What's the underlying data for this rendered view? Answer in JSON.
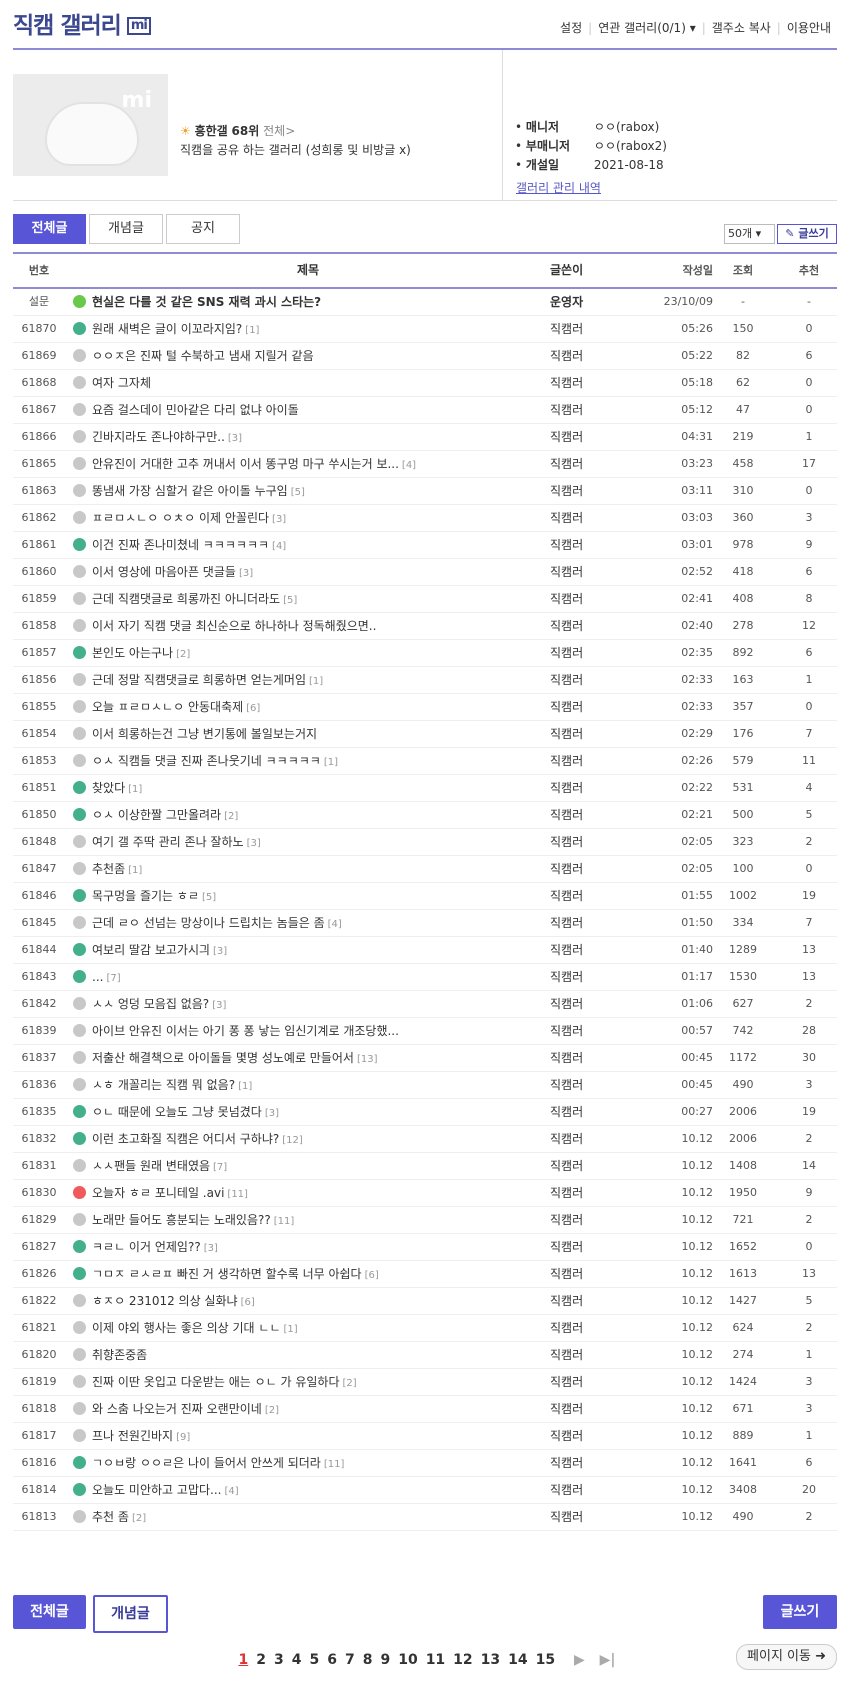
{
  "header": {
    "title": "직캠 갤러리",
    "badge": "mi",
    "links": [
      "설정",
      "연관 갤러리(0/1) ▾",
      "갤주소 복사",
      "이용안내"
    ]
  },
  "info": {
    "thumb_mark": "mi",
    "rank_label": "흥한갤",
    "rank_value": "68위",
    "rank_all": "전체",
    "description": "직캠을 공유 하는 갤러리 (성희롱 및 비방글 x)",
    "manager_label": "매니저",
    "manager_value": "ㅇㅇ(rabox)",
    "submanager_label": "부매니저",
    "submanager_value": "ㅇㅇ(rabox2)",
    "opened_label": "개설일",
    "opened_value": "2021-08-18",
    "log_link": "갤러리 관리 내역"
  },
  "tabs": {
    "all": "전체글",
    "concept": "개념글",
    "notice": "공지"
  },
  "list_controls": {
    "count": "50개",
    "write": "글쓰기"
  },
  "table": {
    "headers": {
      "no": "번호",
      "title": "제목",
      "writer": "글쓴이",
      "date": "작성일",
      "views": "조회",
      "recommends": "추천"
    },
    "rows": [
      {
        "no": "설문",
        "icon": "not",
        "title": "현실은 다를 것 같은 SNS 재력 과시 스타는?",
        "cm": "",
        "writer": "운영자",
        "date": "23/10/09",
        "views": "-",
        "rec": "-",
        "notice": true
      },
      {
        "no": "61870",
        "icon": "img",
        "title": "원래 새벽은 글이 이꼬라지임?",
        "cm": "[1]",
        "writer": "직캠러",
        "date": "05:26",
        "views": "150",
        "rec": "0"
      },
      {
        "no": "61869",
        "icon": "txt",
        "title": "ㅇㅇㅈ은 진짜 털 수북하고 냄새 지릴거 같음",
        "cm": "",
        "writer": "직캠러",
        "date": "05:22",
        "views": "82",
        "rec": "6"
      },
      {
        "no": "61868",
        "icon": "txt",
        "title": "여자 그자체",
        "cm": "",
        "writer": "직캠러",
        "date": "05:18",
        "views": "62",
        "rec": "0"
      },
      {
        "no": "61867",
        "icon": "txt",
        "title": "요즘 걸스데이 민아같은 다리 없냐 아이돌",
        "cm": "",
        "writer": "직캠러",
        "date": "05:12",
        "views": "47",
        "rec": "0"
      },
      {
        "no": "61866",
        "icon": "txt",
        "title": "긴바지라도 존나야하구만..",
        "cm": "[3]",
        "writer": "직캠러",
        "date": "04:31",
        "views": "219",
        "rec": "1"
      },
      {
        "no": "61865",
        "icon": "txt",
        "title": "안유진이 거대한 고추 꺼내서 이서 똥구멍 마구 쑤시는거 보...",
        "cm": "[4]",
        "writer": "직캠러",
        "date": "03:23",
        "views": "458",
        "rec": "17"
      },
      {
        "no": "61863",
        "icon": "txt",
        "title": "똥냄새 가장 심할거 같은 아이돌 누구임",
        "cm": "[5]",
        "writer": "직캠러",
        "date": "03:11",
        "views": "310",
        "rec": "0"
      },
      {
        "no": "61862",
        "icon": "txt",
        "title": "ㅍㄹㅁㅅㄴㅇ ㅇㅊㅇ 이제 안꼴린다",
        "cm": "[3]",
        "writer": "직캠러",
        "date": "03:03",
        "views": "360",
        "rec": "3"
      },
      {
        "no": "61861",
        "icon": "img",
        "title": "이건 진짜 존나미쳤네 ㅋㅋㅋㅋㅋㅋ",
        "cm": "[4]",
        "writer": "직캠러",
        "date": "03:01",
        "views": "978",
        "rec": "9"
      },
      {
        "no": "61860",
        "icon": "txt",
        "title": "이서 영상에 마음아픈 댓글들",
        "cm": "[3]",
        "writer": "직캠러",
        "date": "02:52",
        "views": "418",
        "rec": "6"
      },
      {
        "no": "61859",
        "icon": "txt",
        "title": "근데 직캠댓글로 희롱까진 아니더라도",
        "cm": "[5]",
        "writer": "직캠러",
        "date": "02:41",
        "views": "408",
        "rec": "8"
      },
      {
        "no": "61858",
        "icon": "txt",
        "title": "이서 자기 직캠 댓글 최신순으로 하나하나 정독해줬으면..",
        "cm": "",
        "writer": "직캠러",
        "date": "02:40",
        "views": "278",
        "rec": "12"
      },
      {
        "no": "61857",
        "icon": "img",
        "title": "본인도 아는구나",
        "cm": "[2]",
        "writer": "직캠러",
        "date": "02:35",
        "views": "892",
        "rec": "6"
      },
      {
        "no": "61856",
        "icon": "txt",
        "title": "근데 정말 직캠댓글로 희롱하면 얻는게머임",
        "cm": "[1]",
        "writer": "직캠러",
        "date": "02:33",
        "views": "163",
        "rec": "1"
      },
      {
        "no": "61855",
        "icon": "txt",
        "title": "오늘 ㅍㄹㅁㅅㄴㅇ 안동대축제",
        "cm": "[6]",
        "writer": "직캠러",
        "date": "02:33",
        "views": "357",
        "rec": "0"
      },
      {
        "no": "61854",
        "icon": "txt",
        "title": "이서 희롱하는건 그냥 변기통에 볼일보는거지",
        "cm": "",
        "writer": "직캠러",
        "date": "02:29",
        "views": "176",
        "rec": "7"
      },
      {
        "no": "61853",
        "icon": "txt",
        "title": "ㅇㅅ 직캠들 댓글 진짜 존나웃기네 ㅋㅋㅋㅋㅋ",
        "cm": "[1]",
        "writer": "직캠러",
        "date": "02:26",
        "views": "579",
        "rec": "11"
      },
      {
        "no": "61851",
        "icon": "img",
        "title": "찾았다",
        "cm": "[1]",
        "writer": "직캠러",
        "date": "02:22",
        "views": "531",
        "rec": "4"
      },
      {
        "no": "61850",
        "icon": "img",
        "title": "ㅇㅅ 이상한짤 그만올려라",
        "cm": "[2]",
        "writer": "직캠러",
        "date": "02:21",
        "views": "500",
        "rec": "5"
      },
      {
        "no": "61848",
        "icon": "txt",
        "title": "여기 갤 주딱 관리 존나 잘하노",
        "cm": "[3]",
        "writer": "직캠러",
        "date": "02:05",
        "views": "323",
        "rec": "2"
      },
      {
        "no": "61847",
        "icon": "txt",
        "title": "추천좀",
        "cm": "[1]",
        "writer": "직캠러",
        "date": "02:05",
        "views": "100",
        "rec": "0"
      },
      {
        "no": "61846",
        "icon": "img",
        "title": "목구멍을 즐기는 ㅎㄹ",
        "cm": "[5]",
        "writer": "직캠러",
        "date": "01:55",
        "views": "1002",
        "rec": "19"
      },
      {
        "no": "61845",
        "icon": "txt",
        "title": "근데 ㄹㅇ 선넘는 망상이나 드립치는 놈들은 좀",
        "cm": "[4]",
        "writer": "직캠러",
        "date": "01:50",
        "views": "334",
        "rec": "7"
      },
      {
        "no": "61844",
        "icon": "img",
        "title": "여보리 딸감 보고가시긔",
        "cm": "[3]",
        "writer": "직캠러",
        "date": "01:40",
        "views": "1289",
        "rec": "13"
      },
      {
        "no": "61843",
        "icon": "img",
        "title": "...",
        "cm": "[7]",
        "writer": "직캠러",
        "date": "01:17",
        "views": "1530",
        "rec": "13"
      },
      {
        "no": "61842",
        "icon": "txt",
        "title": "ㅅㅅ 엉덩 모음집 없음?",
        "cm": "[3]",
        "writer": "직캠러",
        "date": "01:06",
        "views": "627",
        "rec": "2"
      },
      {
        "no": "61839",
        "icon": "txt",
        "title": "아이브 안유진 이서는 아기 퐁 퐁 낳는 임신기계로 개조당했...",
        "cm": "",
        "writer": "직캠러",
        "date": "00:57",
        "views": "742",
        "rec": "28"
      },
      {
        "no": "61837",
        "icon": "txt",
        "title": "저출산 해결책으로 아이돌들 몇명 성노예로 만들어서",
        "cm": "[13]",
        "writer": "직캠러",
        "date": "00:45",
        "views": "1172",
        "rec": "30"
      },
      {
        "no": "61836",
        "icon": "txt",
        "title": "ㅅㅎ 개꼴리는 직캠 뭐 없음?",
        "cm": "[1]",
        "writer": "직캠러",
        "date": "00:45",
        "views": "490",
        "rec": "3"
      },
      {
        "no": "61835",
        "icon": "img",
        "title": "ㅇㄴ 때문에 오늘도 그냥 못넘겼다",
        "cm": "[3]",
        "writer": "직캠러",
        "date": "00:27",
        "views": "2006",
        "rec": "19"
      },
      {
        "no": "61832",
        "icon": "img",
        "title": "이런 초고화질 직캠은 어디서 구하냐?",
        "cm": "[12]",
        "writer": "직캠러",
        "date": "10.12",
        "views": "2006",
        "rec": "2"
      },
      {
        "no": "61831",
        "icon": "txt",
        "title": "ㅅㅅ팬들 원래 변태였음",
        "cm": "[7]",
        "writer": "직캠러",
        "date": "10.12",
        "views": "1408",
        "rec": "14"
      },
      {
        "no": "61830",
        "icon": "mov",
        "title": "오늘자 ㅎㄹ 포니테일 .avi",
        "cm": "[11]",
        "writer": "직캠러",
        "date": "10.12",
        "views": "1950",
        "rec": "9"
      },
      {
        "no": "61829",
        "icon": "txt",
        "title": "노래만 들어도 흥분되는 노래있음??",
        "cm": "[11]",
        "writer": "직캠러",
        "date": "10.12",
        "views": "721",
        "rec": "2"
      },
      {
        "no": "61827",
        "icon": "img",
        "title": "ㅋㄹㄴ 이거 언제임??",
        "cm": "[3]",
        "writer": "직캠러",
        "date": "10.12",
        "views": "1652",
        "rec": "0"
      },
      {
        "no": "61826",
        "icon": "img",
        "title": "ㄱㅁㅈ ㄹㅅㄹㅍ 빠진 거 생각하면 할수록 너무 아쉽다",
        "cm": "[6]",
        "writer": "직캠러",
        "date": "10.12",
        "views": "1613",
        "rec": "13"
      },
      {
        "no": "61822",
        "icon": "txt",
        "title": "ㅎㅈㅇ 231012 의상 실화냐",
        "cm": "[6]",
        "writer": "직캠러",
        "date": "10.12",
        "views": "1427",
        "rec": "5"
      },
      {
        "no": "61821",
        "icon": "txt",
        "title": "이제 야외 행사는 좋은 의상 기대 ㄴㄴ",
        "cm": "[1]",
        "writer": "직캠러",
        "date": "10.12",
        "views": "624",
        "rec": "2"
      },
      {
        "no": "61820",
        "icon": "txt",
        "title": "취향존중좀",
        "cm": "",
        "writer": "직캠러",
        "date": "10.12",
        "views": "274",
        "rec": "1"
      },
      {
        "no": "61819",
        "icon": "txt",
        "title": "진짜 이딴 옷입고 다운받는 애는 ㅇㄴ 가 유일하다",
        "cm": "[2]",
        "writer": "직캠러",
        "date": "10.12",
        "views": "1424",
        "rec": "3"
      },
      {
        "no": "61818",
        "icon": "txt",
        "title": "와 스춤 나오는거 진짜 오랜만이네",
        "cm": "[2]",
        "writer": "직캠러",
        "date": "10.12",
        "views": "671",
        "rec": "3"
      },
      {
        "no": "61817",
        "icon": "txt",
        "title": "프나 전원긴바지",
        "cm": "[9]",
        "writer": "직캠러",
        "date": "10.12",
        "views": "889",
        "rec": "1"
      },
      {
        "no": "61816",
        "icon": "img",
        "title": "ㄱㅇㅂ랑 ㅇㅇㄹ은 나이 들어서 안쓰게 되더라",
        "cm": "[11]",
        "writer": "직캠러",
        "date": "10.12",
        "views": "1641",
        "rec": "6"
      },
      {
        "no": "61814",
        "icon": "img",
        "title": "오늘도 미안하고 고맙다...",
        "cm": "[4]",
        "writer": "직캠러",
        "date": "10.12",
        "views": "3408",
        "rec": "20"
      },
      {
        "no": "61813",
        "icon": "txt",
        "title": "추천 좀",
        "cm": "[2]",
        "writer": "직캠러",
        "date": "10.12",
        "views": "490",
        "rec": "2"
      }
    ]
  },
  "bottom": {
    "all": "전체글",
    "concept": "개념글",
    "write": "글쓰기"
  },
  "pager": {
    "pages": [
      "1",
      "2",
      "3",
      "4",
      "5",
      "6",
      "7",
      "8",
      "9",
      "10",
      "11",
      "12",
      "13",
      "14",
      "15"
    ],
    "current": "1",
    "next": "▶",
    "last": "▶|",
    "move": "페이지 이동 ➜"
  },
  "colors": {
    "accent": "#5856d6",
    "title": "#3b4890",
    "border": "#8c8bd3"
  }
}
